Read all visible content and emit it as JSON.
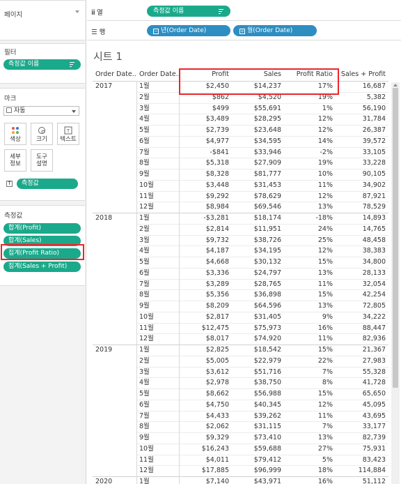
{
  "panels": {
    "pages_title": "페이지",
    "filters_title": "필터",
    "filter_pill": "측정값 이름",
    "marks_title": "마크",
    "mark_type": "자동",
    "mark_buttons": [
      "색상",
      "크기",
      "텍스트",
      "세부\n정보",
      "도구\n설명"
    ],
    "marks_text_pill": "측정값",
    "measures_title": "측정값",
    "measures": [
      "합계(Profit)",
      "합계(Sales)",
      "집계(Profit Ratio)",
      "집계(Sales + Profit)"
    ]
  },
  "shelves": {
    "columns_label": "열",
    "columns_pill": "측정값 이름",
    "rows_label": "행",
    "rows_pills": [
      "년(Order Date)",
      "월(Order Date)"
    ]
  },
  "sheet_title": "시트 1",
  "table": {
    "headers": [
      "Order Date..",
      "Order Date..",
      "Profit",
      "Sales",
      "Profit Ratio",
      "Sales + Profit"
    ],
    "years": [
      {
        "year": "2017",
        "rows": [
          [
            "1월",
            "$2,450",
            "$14,237",
            "17%",
            "16,687"
          ],
          [
            "2월",
            "$862",
            "$4,520",
            "19%",
            "5,382"
          ],
          [
            "3월",
            "$499",
            "$55,691",
            "1%",
            "56,190"
          ],
          [
            "4월",
            "$3,489",
            "$28,295",
            "12%",
            "31,784"
          ],
          [
            "5월",
            "$2,739",
            "$23,648",
            "12%",
            "26,387"
          ],
          [
            "6월",
            "$4,977",
            "$34,595",
            "14%",
            "39,572"
          ],
          [
            "7월",
            "-$841",
            "$33,946",
            "-2%",
            "33,105"
          ],
          [
            "8월",
            "$5,318",
            "$27,909",
            "19%",
            "33,228"
          ],
          [
            "9월",
            "$8,328",
            "$81,777",
            "10%",
            "90,105"
          ],
          [
            "10월",
            "$3,448",
            "$31,453",
            "11%",
            "34,902"
          ],
          [
            "11월",
            "$9,292",
            "$78,629",
            "12%",
            "87,921"
          ],
          [
            "12월",
            "$8,984",
            "$69,546",
            "13%",
            "78,529"
          ]
        ]
      },
      {
        "year": "2018",
        "rows": [
          [
            "1월",
            "-$3,281",
            "$18,174",
            "-18%",
            "14,893"
          ],
          [
            "2월",
            "$2,814",
            "$11,951",
            "24%",
            "14,765"
          ],
          [
            "3월",
            "$9,732",
            "$38,726",
            "25%",
            "48,458"
          ],
          [
            "4월",
            "$4,187",
            "$34,195",
            "12%",
            "38,383"
          ],
          [
            "5월",
            "$4,668",
            "$30,132",
            "15%",
            "34,800"
          ],
          [
            "6월",
            "$3,336",
            "$24,797",
            "13%",
            "28,133"
          ],
          [
            "7월",
            "$3,289",
            "$28,765",
            "11%",
            "32,054"
          ],
          [
            "8월",
            "$5,356",
            "$36,898",
            "15%",
            "42,254"
          ],
          [
            "9월",
            "$8,209",
            "$64,596",
            "13%",
            "72,805"
          ],
          [
            "10월",
            "$2,817",
            "$31,405",
            "9%",
            "34,222"
          ],
          [
            "11월",
            "$12,475",
            "$75,973",
            "16%",
            "88,447"
          ],
          [
            "12월",
            "$8,017",
            "$74,920",
            "11%",
            "82,936"
          ]
        ]
      },
      {
        "year": "2019",
        "rows": [
          [
            "1월",
            "$2,825",
            "$18,542",
            "15%",
            "21,367"
          ],
          [
            "2월",
            "$5,005",
            "$22,979",
            "22%",
            "27,983"
          ],
          [
            "3월",
            "$3,612",
            "$51,716",
            "7%",
            "55,328"
          ],
          [
            "4월",
            "$2,978",
            "$38,750",
            "8%",
            "41,728"
          ],
          [
            "5월",
            "$8,662",
            "$56,988",
            "15%",
            "65,650"
          ],
          [
            "6월",
            "$4,750",
            "$40,345",
            "12%",
            "45,095"
          ],
          [
            "7월",
            "$4,433",
            "$39,262",
            "11%",
            "43,695"
          ],
          [
            "8월",
            "$2,062",
            "$31,115",
            "7%",
            "33,177"
          ],
          [
            "9월",
            "$9,329",
            "$73,410",
            "13%",
            "82,739"
          ],
          [
            "10월",
            "$16,243",
            "$59,688",
            "27%",
            "75,931"
          ],
          [
            "11월",
            "$4,011",
            "$79,412",
            "5%",
            "83,423"
          ],
          [
            "12월",
            "$17,885",
            "$96,999",
            "18%",
            "114,884"
          ]
        ]
      },
      {
        "year": "2020",
        "rows": [
          [
            "1월",
            "$7,140",
            "$43,971",
            "16%",
            "51,112"
          ]
        ]
      }
    ]
  }
}
